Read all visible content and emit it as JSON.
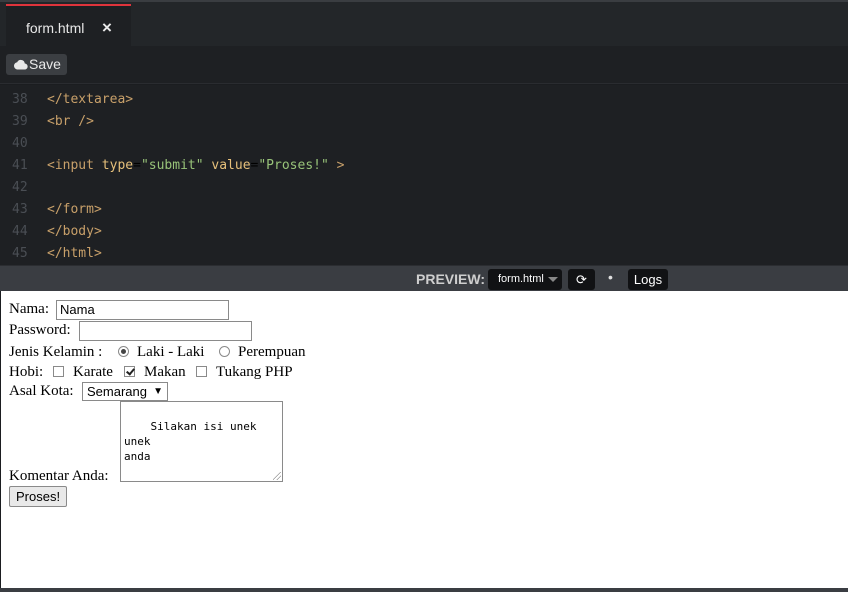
{
  "tab": {
    "label": "form.html",
    "close_icon": "×"
  },
  "toolbar": {
    "save_label": "Save"
  },
  "editor": {
    "lines": [
      {
        "num": "38",
        "code": "</textarea>"
      },
      {
        "num": "39",
        "code": "<br />"
      },
      {
        "num": "40",
        "code": ""
      },
      {
        "num": "41",
        "code": "<input type=\"submit\" value=\"Proses!\" >"
      },
      {
        "num": "42",
        "code": ""
      },
      {
        "num": "43",
        "code": "</form>"
      },
      {
        "num": "44",
        "code": "</body>"
      },
      {
        "num": "45",
        "code": "</html>"
      }
    ]
  },
  "previewbar": {
    "label": "PREVIEW:",
    "file": "form.html",
    "refresh_icon": "⟳",
    "dot": "•",
    "logs": "Logs"
  },
  "form": {
    "nama_label": "Nama:",
    "nama_value": "Nama",
    "password_label": "Password:",
    "password_value": "",
    "gender_label": "Jenis Kelamin :",
    "gender_options": [
      "Laki - Laki",
      "Perempuan"
    ],
    "gender_selected": "Laki - Laki",
    "hobi_label": "Hobi:",
    "hobi_options": [
      "Karate",
      "Makan",
      "Tukang PHP"
    ],
    "hobi_checked": [
      "Makan"
    ],
    "kota_label": "Asal Kota:",
    "kota_value": "Semarang",
    "kota_arrow": "▼",
    "komentar_label": "Komentar Anda:",
    "komentar_value": "Silakan isi unek unek\nanda",
    "submit_label": "Proses!"
  }
}
